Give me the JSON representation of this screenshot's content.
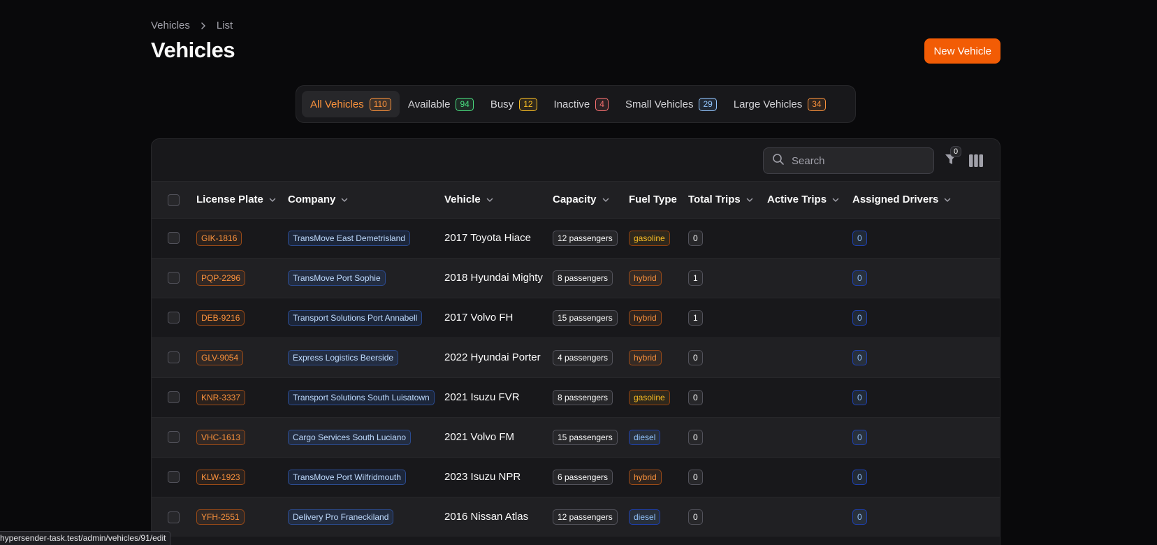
{
  "breadcrumb": {
    "items": [
      "Vehicles",
      "List"
    ]
  },
  "page": {
    "title": "Vehicles",
    "new_button": "New Vehicle"
  },
  "tabs": [
    {
      "label": "All Vehicles",
      "count": "110",
      "active": true,
      "color": "orange"
    },
    {
      "label": "Available",
      "count": "94",
      "color": "green"
    },
    {
      "label": "Busy",
      "count": "12",
      "color": "yellow"
    },
    {
      "label": "Inactive",
      "count": "4",
      "color": "red"
    },
    {
      "label": "Small Vehicles",
      "count": "29",
      "color": "blue"
    },
    {
      "label": "Large Vehicles",
      "count": "34",
      "color": "orange"
    }
  ],
  "toolbar": {
    "search_placeholder": "Search",
    "filter_count": "0",
    "icons": [
      "search-icon",
      "filter-icon",
      "columns-icon"
    ]
  },
  "table": {
    "columns": [
      "License Plate",
      "Company",
      "Vehicle",
      "Capacity",
      "Fuel Type",
      "Total Trips",
      "Active Trips",
      "Assigned Drivers"
    ],
    "sortable": [
      true,
      true,
      true,
      true,
      false,
      true,
      true,
      true
    ],
    "rows": [
      {
        "plate": "GIK-1816",
        "company": "TransMove East Demetrisland",
        "vehicle": "2017 Toyota Hiace",
        "capacity": "12 passengers",
        "fuel": "gasoline",
        "total_trips": "0",
        "active_trips": "",
        "drivers": "0"
      },
      {
        "plate": "PQP-2296",
        "company": "TransMove Port Sophie",
        "vehicle": "2018 Hyundai Mighty",
        "capacity": "8 passengers",
        "fuel": "hybrid",
        "total_trips": "1",
        "active_trips": "",
        "drivers": "0"
      },
      {
        "plate": "DEB-9216",
        "company": "Transport Solutions Port Annabell",
        "vehicle": "2017 Volvo FH",
        "capacity": "15 passengers",
        "fuel": "hybrid",
        "total_trips": "1",
        "active_trips": "",
        "drivers": "0"
      },
      {
        "plate": "GLV-9054",
        "company": "Express Logistics Beerside",
        "vehicle": "2022 Hyundai Porter",
        "capacity": "4 passengers",
        "fuel": "hybrid",
        "total_trips": "0",
        "active_trips": "",
        "drivers": "0"
      },
      {
        "plate": "KNR-3337",
        "company": "Transport Solutions South Luisatown",
        "vehicle": "2021 Isuzu FVR",
        "capacity": "8 passengers",
        "fuel": "gasoline",
        "total_trips": "0",
        "active_trips": "",
        "drivers": "0"
      },
      {
        "plate": "VHC-1613",
        "company": "Cargo Services South Luciano",
        "vehicle": "2021 Volvo FM",
        "capacity": "15 passengers",
        "fuel": "diesel",
        "total_trips": "0",
        "active_trips": "",
        "drivers": "0"
      },
      {
        "plate": "KLW-1923",
        "company": "TransMove Port Wilfridmouth",
        "vehicle": "2023 Isuzu NPR",
        "capacity": "6 passengers",
        "fuel": "hybrid",
        "total_trips": "0",
        "active_trips": "",
        "drivers": "0"
      },
      {
        "plate": "YFH-2551",
        "company": "Delivery Pro Franeckiland",
        "vehicle": "2016 Nissan Atlas",
        "capacity": "12 passengers",
        "fuel": "diesel",
        "total_trips": "0",
        "active_trips": "",
        "drivers": "0"
      }
    ]
  },
  "status_bar": {
    "url": "hypersender-task.test/admin/vehicles/91/edit"
  },
  "colors": {
    "accent": "#f25c05",
    "background": "#09090b",
    "panel": "#18181b"
  }
}
